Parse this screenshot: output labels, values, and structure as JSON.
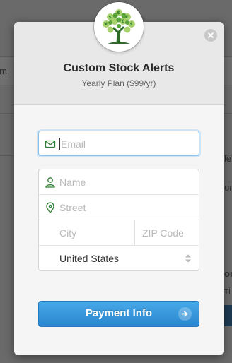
{
  "background": {
    "left_fragment": "m",
    "right_fragments": [
      "le",
      "or",
      "on",
      "Tİ"
    ]
  },
  "modal": {
    "logo": "money-tree-logo",
    "title": "Custom Stock Alerts",
    "subtitle": "Yearly Plan ($99/yr)",
    "close_icon": "close-icon"
  },
  "form": {
    "email": {
      "value": "",
      "placeholder": "Email",
      "icon": "envelope-icon"
    },
    "name": {
      "value": "",
      "placeholder": "Name",
      "icon": "person-icon"
    },
    "street": {
      "value": "",
      "placeholder": "Street",
      "icon": "location-pin-icon"
    },
    "city": {
      "value": "",
      "placeholder": "City"
    },
    "zip": {
      "value": "",
      "placeholder": "ZIP Code"
    },
    "country": {
      "selected": "United States"
    }
  },
  "submit": {
    "label": "Payment Info",
    "icon": "arrow-right-circle-icon"
  },
  "colors": {
    "accent_blue": "#2a86cf",
    "icon_green": "#2e7d32"
  }
}
